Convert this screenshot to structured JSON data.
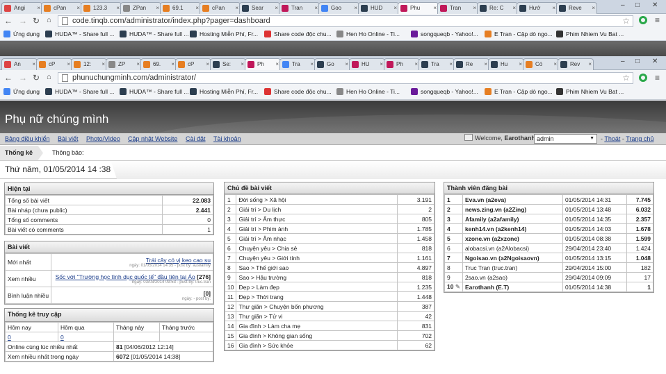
{
  "browser_back": {
    "tabs": [
      {
        "label": "Angi"
      },
      {
        "label": "cPan"
      },
      {
        "label": "123.3"
      },
      {
        "label": "ZPan"
      },
      {
        "label": "69.1"
      },
      {
        "label": "cPan"
      },
      {
        "label": "Sear"
      },
      {
        "label": "Tran"
      },
      {
        "label": "Goo"
      },
      {
        "label": "HUD"
      },
      {
        "label": "Phu"
      },
      {
        "label": "Tran"
      },
      {
        "label": "Re: C"
      },
      {
        "label": "Hướ"
      },
      {
        "label": "Reve"
      }
    ],
    "url": "code.tinqb.com/administrator/index.php?pager=dashboard"
  },
  "browser_front": {
    "tabs": [
      {
        "label": "An"
      },
      {
        "label": "cP"
      },
      {
        "label": "12:"
      },
      {
        "label": "ZP"
      },
      {
        "label": "69."
      },
      {
        "label": "cP"
      },
      {
        "label": "Se:"
      },
      {
        "label": "Ph"
      },
      {
        "label": "Tra"
      },
      {
        "label": "Go"
      },
      {
        "label": "HU"
      },
      {
        "label": "Ph"
      },
      {
        "label": "Tra"
      },
      {
        "label": "Re"
      },
      {
        "label": "Hu"
      },
      {
        "label": "Có"
      },
      {
        "label": "Rev"
      }
    ],
    "url": "phunuchungminh.com/administrator/"
  },
  "bookmarks": [
    "Ứng dụng",
    "HUDA™ - Share full ...",
    "HUDA™ - Share full ...",
    "Hosting Miễn Phí, Fr...",
    "Share code độc chu...",
    "Hen Ho Online - Ti...",
    "songqueqb - Yahoo!...",
    "E Tran - Cập dò ngo...",
    "Phim Nhiem Vu Bat ..."
  ],
  "site": {
    "title": "Phụ nữ chúng mình",
    "nav": [
      "Bảng điều khiển",
      "Bài viết",
      "Photo/Video",
      "Cập nhật Website",
      "Cài đặt",
      "Tài khoản"
    ],
    "welcome_prefix": "Welcome,",
    "welcome_user": "Earothanh",
    "role": "admin",
    "logout": "Thoát",
    "home": "Trang chủ",
    "crumb": "Thống kê",
    "notice": "Thông báo:",
    "date": "Thứ năm, 01/05/2014 14 :38"
  },
  "hien_tai": {
    "title": "Hiện tại",
    "rows": [
      [
        "Tổng số bài viết",
        "22.083"
      ],
      [
        "Bài nháp (chưa public)",
        "2.441"
      ],
      [
        "Tổng số comments",
        "0"
      ],
      [
        "Bài viết có comments",
        "1"
      ]
    ]
  },
  "bai_viet": {
    "title": "Bài viết",
    "moi_label": "Mới nhất",
    "moi_link": "Trái cây có vị keo cao su",
    "moi_meta": "ngày: 01/05/2014 14:35 - post by: a2afamily",
    "xem_label": "Xem nhiều",
    "xem_link": "Sốc với \"Trường học tình dục quốc tế\" đầu tiên tại Áo",
    "xem_count": "[276]",
    "xem_meta": "ngày: 03/03/2014 09:53 - post by: truc.tran",
    "bl_label": "Bình luận nhiều",
    "bl_count": "[0]",
    "bl_meta": "ngày: - post by:"
  },
  "truy_cap": {
    "title": "Thống kê truy cập",
    "headers": [
      "Hôm nay",
      "Hôm qua",
      "Tháng này",
      "Tháng trước"
    ],
    "values": [
      "0",
      "0",
      "",
      ""
    ],
    "online_label": "Online cùng lúc nhiều nhất",
    "online_value": "81",
    "online_date": "[04/06/2012 12:14]",
    "most_label": "Xem nhiều nhất trong ngày",
    "most_value": "6072",
    "most_date": "[01/05/2014 14:38]"
  },
  "chu_de": {
    "title": "Chủ đề bài viết",
    "rows": [
      [
        "1",
        "Đời sống > Xã hội",
        "3.191"
      ],
      [
        "2",
        "Giải trí > Du lịch",
        "2"
      ],
      [
        "3",
        "Giải trí > Ẩm thực",
        "805"
      ],
      [
        "4",
        "Giải trí > Phim ảnh",
        "1.785"
      ],
      [
        "5",
        "Giải trí > Âm nhạc",
        "1.458"
      ],
      [
        "6",
        "Chuyện yêu > Chia sẻ",
        "818"
      ],
      [
        "7",
        "Chuyện yêu > Giới tính",
        "1.161"
      ],
      [
        "8",
        "Sao > Thế giới sao",
        "4.897"
      ],
      [
        "9",
        "Sao > Hậu trường",
        "818"
      ],
      [
        "10",
        "Đẹp > Làm đẹp",
        "1.235"
      ],
      [
        "11",
        "Đẹp > Thời trang",
        "1.448"
      ],
      [
        "12",
        "Thư giãn > Chuyện bốn phương",
        "387"
      ],
      [
        "13",
        "Thư giãn > Tử vi",
        "42"
      ],
      [
        "14",
        "Gia đình > Làm cha mẹ",
        "831"
      ],
      [
        "15",
        "Gia đình > Không gian sống",
        "702"
      ],
      [
        "16",
        "Gia đình > Sức khỏe",
        "62"
      ]
    ]
  },
  "thanh_vien": {
    "title": "Thành viên đăng bài",
    "rows": [
      [
        "1",
        "Eva.vn (a2eva)",
        "01/05/2014 14:31",
        "7.745",
        true
      ],
      [
        "2",
        "news.zing.vn (a2Zing)",
        "01/05/2014 13:48",
        "6.032",
        true
      ],
      [
        "3",
        "Afamily (a2afamily)",
        "01/05/2014 14:35",
        "2.357",
        true
      ],
      [
        "4",
        "kenh14.vn (a2kenh14)",
        "01/05/2014 14:03",
        "1.678",
        true
      ],
      [
        "5",
        "xzone.vn (a2xzone)",
        "01/05/2014 08:38",
        "1.599",
        true
      ],
      [
        "6",
        "alobacsi.vn (a2Alobacsi)",
        "29/04/2014 23:40",
        "1.424",
        false
      ],
      [
        "7",
        "Ngoisao.vn (a2Ngoisaovn)",
        "01/05/2014 13:15",
        "1.048",
        true
      ],
      [
        "8",
        "Truc Tran (truc.tran)",
        "29/04/2014 15:00",
        "182",
        false
      ],
      [
        "9",
        "2sao.vn (a2sao)",
        "29/04/2014 09:09",
        "17",
        false
      ],
      [
        "10",
        "Earothanh (E.T)",
        "01/05/2014 14:38",
        "1",
        true
      ]
    ]
  }
}
